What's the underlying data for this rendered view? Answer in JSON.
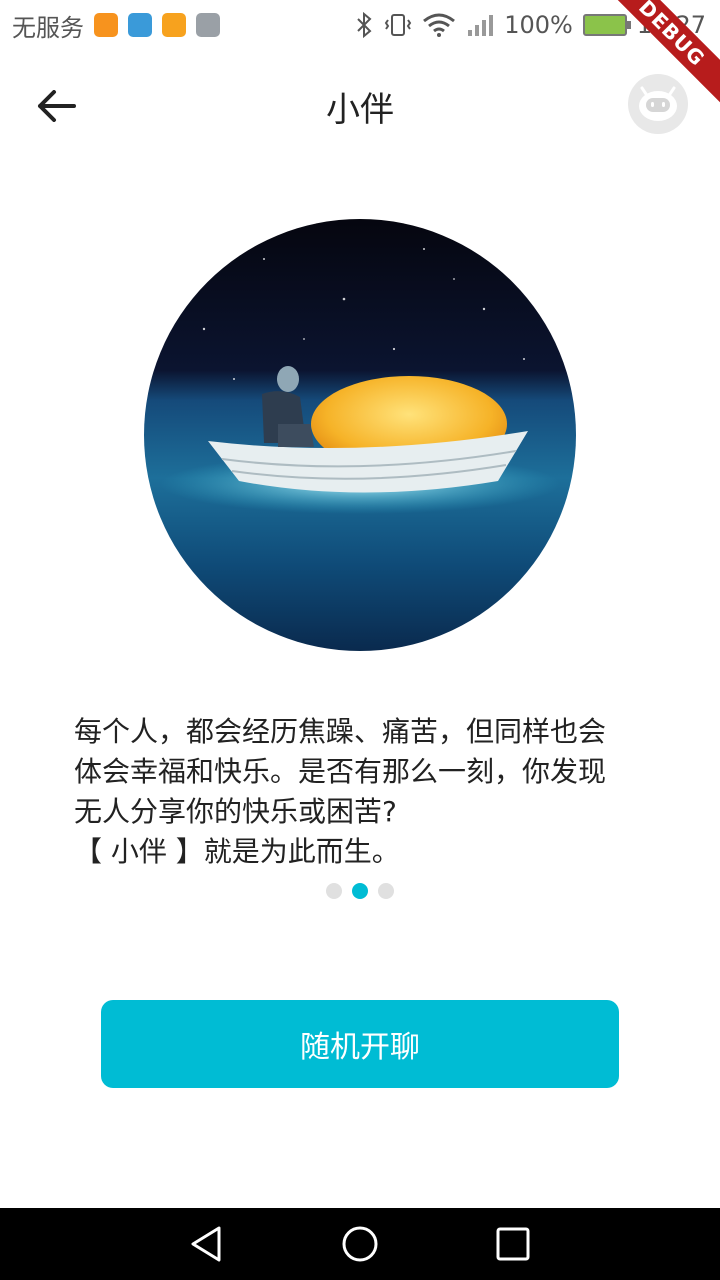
{
  "status_bar": {
    "carrier": "无服务",
    "app_icons": [
      "uc-browser-icon",
      "usb-icon",
      "uc-icon",
      "gallery-icon"
    ],
    "battery": "100%",
    "time": "16:27"
  },
  "debug_banner": "DEBUG",
  "app_bar": {
    "title": "小伴"
  },
  "intro": {
    "lines": [
      "每个人，都会经历焦躁、痛苦，但同样也会",
      "体会幸福和快乐。是否有那么一刻，你发现",
      "无人分享你的快乐或困苦?",
      "【 小伴 】就是为此而生。"
    ],
    "pager": {
      "total": 3,
      "active": 1
    }
  },
  "actions": {
    "random_chat_label": "随机开聊"
  },
  "colors": {
    "accent": "#00bcd4",
    "dot_inactive": "#e0e0e0"
  }
}
